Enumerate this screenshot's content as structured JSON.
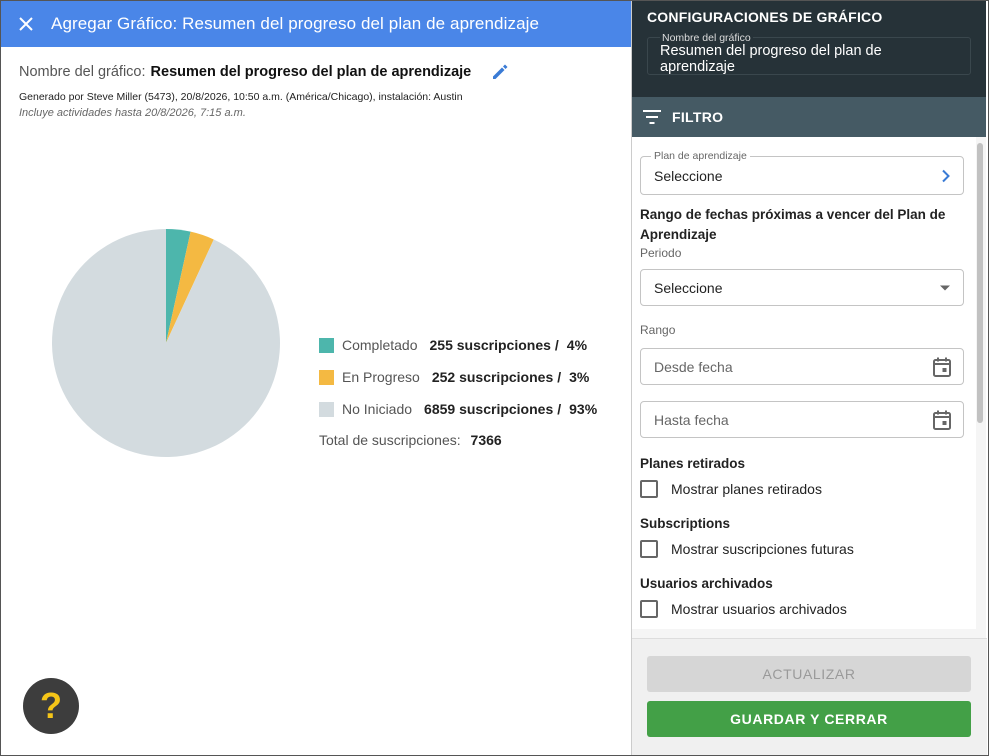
{
  "header": {
    "title": "Agregar Gráfico: Resumen del progreso del plan de aprendizaje",
    "close_icon": "close-icon"
  },
  "info": {
    "name_label": "Nombre del gráfico:",
    "name_value": "Resumen del progreso del plan de aprendizaje",
    "edit_icon": "pencil-icon",
    "generated": "Generado por Steve Miller (5473), 20/8/2026, 10:50 a.m. (América/Chicago), instalación: Austin",
    "includes": "Incluye actividades hasta 20/8/2026, 7:15 a.m."
  },
  "chart_data": {
    "type": "pie",
    "categories": [
      "Completado",
      "En Progreso",
      "No Iniciado"
    ],
    "values": [
      255,
      252,
      6859
    ],
    "counts_text": [
      "255 suscripciones",
      "252 suscripciones",
      "6859 suscripciones"
    ],
    "percent_text": [
      "4%",
      "3%",
      "93%"
    ],
    "colors": [
      "#4db6ac",
      "#f4b942",
      "#d3dbdf"
    ],
    "total_label": "Total de suscripciones:",
    "total_value": "7366"
  },
  "help": {
    "label": "?"
  },
  "panel": {
    "title": "CONFIGURACIONES DE GRÁFICO",
    "chart_name_label": "Nombre del gráfico",
    "chart_name_value": "Resumen del progreso del plan de aprendizaje",
    "filter_title": "FILTRO",
    "plan_label": "Plan de aprendizaje",
    "plan_value": "Seleccione",
    "date_range_title": "Rango de fechas próximas a vencer del Plan de Aprendizaje",
    "period_label": "Periodo",
    "period_value": "Seleccione",
    "range_label": "Rango",
    "from_placeholder": "Desde fecha",
    "to_placeholder": "Hasta fecha",
    "retired_title": "Planes retirados",
    "retired_check": "Mostrar planes retirados",
    "subs_title": "Subscriptions",
    "subs_check": "Mostrar suscripciones futuras",
    "archived_title": "Usuarios archivados",
    "archived_check": "Mostrar usuarios archivados",
    "update_button": "ACTUALIZAR",
    "save_button": "GUARDAR Y CERRAR"
  }
}
